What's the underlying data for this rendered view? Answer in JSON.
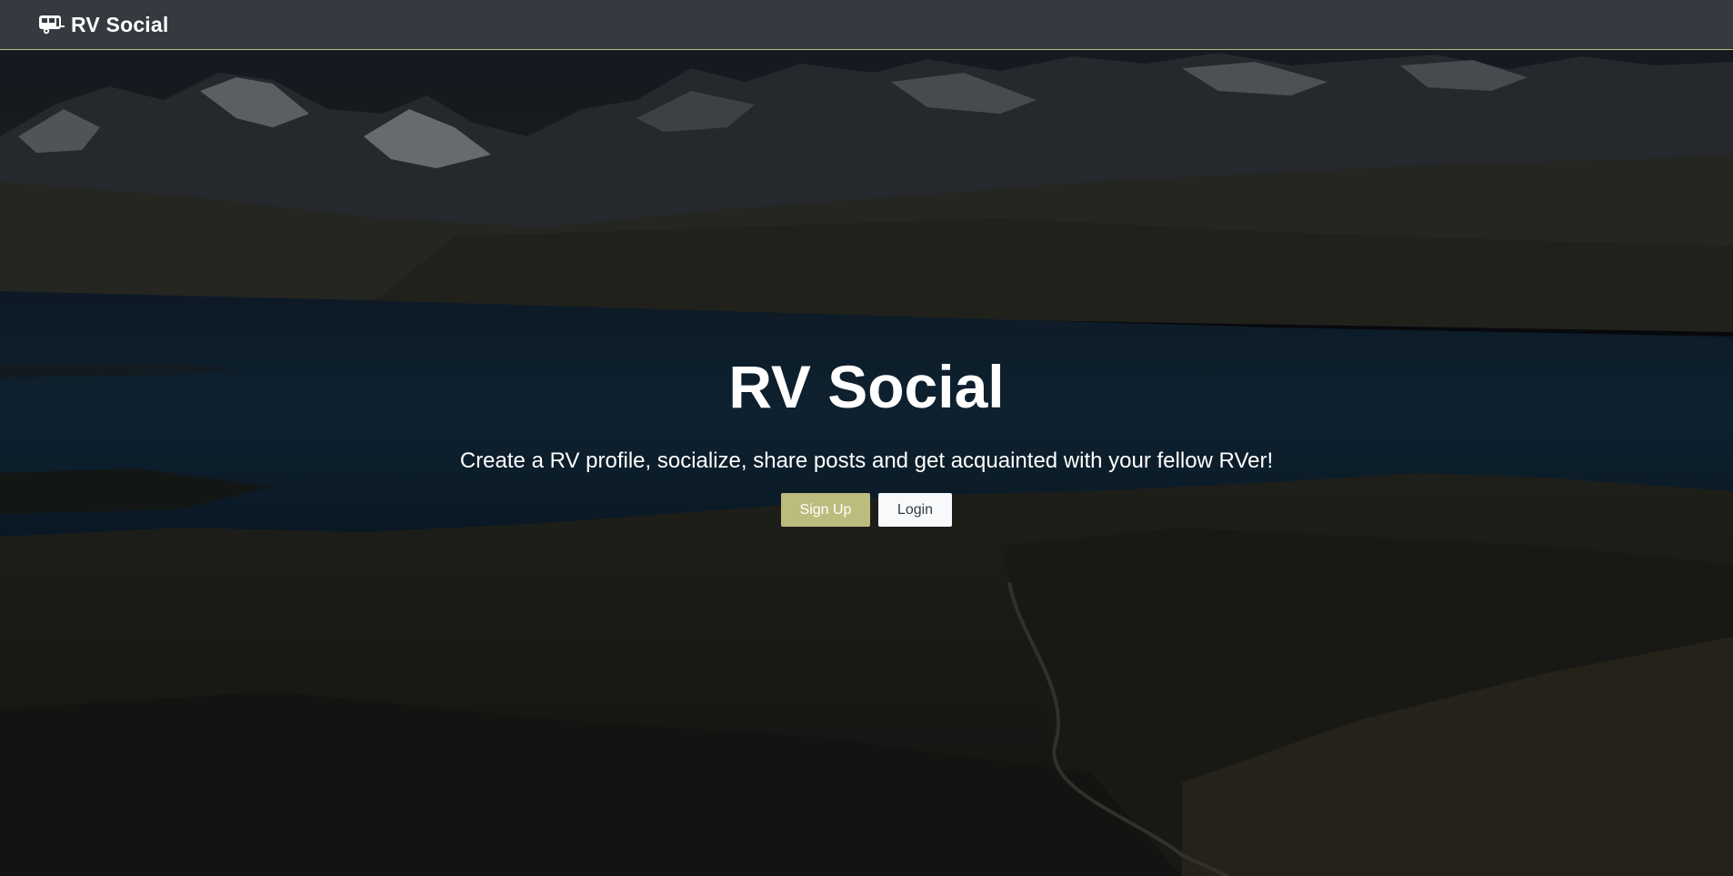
{
  "navbar": {
    "brand_text": "RV Social",
    "brand_icon": "rv-trailer-icon",
    "accent_color": "#bcbc7e",
    "background_color": "#343a40"
  },
  "hero": {
    "title": "RV Social",
    "subtitle": "Create a RV profile, socialize, share posts and get acquainted with your fellow RVer!",
    "signup_label": "Sign Up",
    "login_label": "Login",
    "signup_color": "#bcbc7e",
    "login_color": "#f8f9fa"
  },
  "background": {
    "description_icon": "mountain-lake-landscape"
  }
}
